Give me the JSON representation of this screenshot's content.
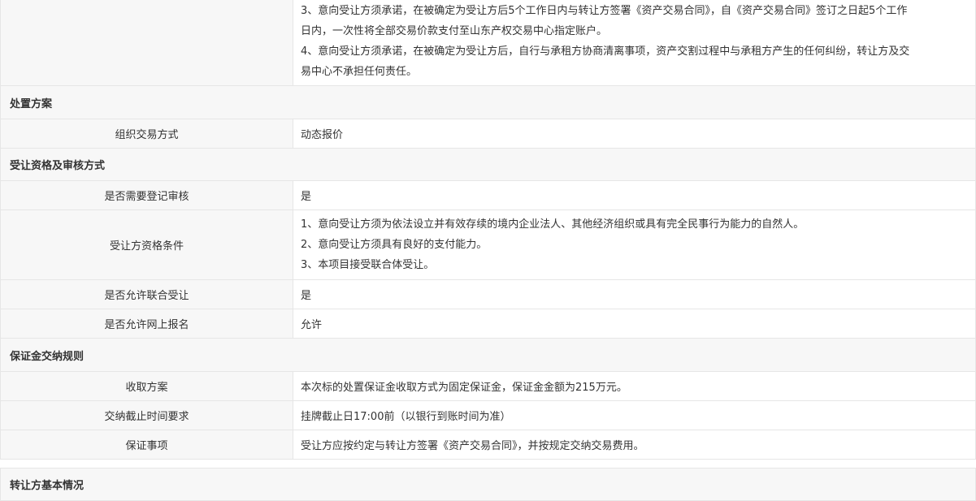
{
  "sections": {
    "disposal_plan": "处置方案",
    "qualification": "受让资格及审核方式",
    "deposit_rules": "保证金交纳规则",
    "transferor_info": "转让方基本情况"
  },
  "commitments": {
    "item3_line1": "3、意向受让方须承诺，在被确定为受让方后5个工作日内与转让方签署《资产交易合同》，自《资产交易合同》签订之日起5个工作",
    "item3_line2": "日内，一次性将全部交易价款支付至山东产权交易中心指定账户。",
    "item4_line1": "4、意向受让方须承诺，在被确定为受让方后，自行与承租方协商清离事项，资产交割过程中与承租方产生的任何纠纷，转让方及交",
    "item4_line2": "易中心不承担任何责任。"
  },
  "disposal_plan": {
    "trade_method_label": "组织交易方式",
    "trade_method_value": "动态报价"
  },
  "qualification": {
    "registration_review_label": "是否需要登记审核",
    "registration_review_value": "是",
    "conditions_label": "受让方资格条件",
    "conditions": [
      "1、意向受让方须为依法设立并有效存续的境内企业法人、其他经济组织或具有完全民事行为能力的自然人。",
      "2、意向受让方须具有良好的支付能力。",
      "3、本项目接受联合体受让。"
    ],
    "joint_transfer_label": "是否允许联合受让",
    "joint_transfer_value": "是",
    "online_signup_label": "是否允许网上报名",
    "online_signup_value": "允许"
  },
  "deposit_rules": {
    "collection_plan_label": "收取方案",
    "collection_plan_value": "本次标的处置保证金收取方式为固定保证金，保证金金额为215万元。",
    "deadline_label": "交纳截止时间要求",
    "deadline_value": "挂牌截止日17:00前（以银行到账时间为准）",
    "deposit_matters_label": "保证事项",
    "deposit_matters_value": "受让方应按约定与转让方签署《资产交易合同》，并按规定交纳交易费用。"
  }
}
